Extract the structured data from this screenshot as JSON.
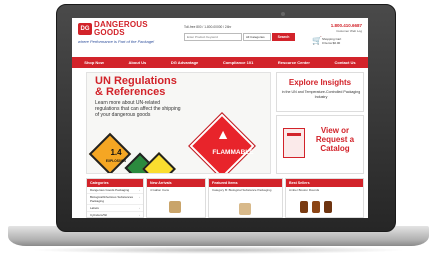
{
  "colors": {
    "brand_red": "#d2232a",
    "nav_text": "#ffffff",
    "tagline_blue": "#2b4c9a"
  },
  "header": {
    "logo_badge": "DG",
    "logo_line1": "DANGEROUS",
    "logo_line2": "GOODS",
    "tagline": "where Performance is Part of the Package!",
    "tollfree": "Toll-free 800 / 1-800-00000 / 24hr",
    "search_placeholder": "Enter Product Keyword",
    "category_select": "All Categories",
    "search_label": "Search",
    "phone": "1.800.410.6687",
    "phone_sub": "Customer Web Log",
    "cart_line1": "Shopping Cart",
    "cart_line2": "0 Items $0.00"
  },
  "nav": {
    "items": [
      "Shop Now",
      "About Us",
      "DG Advantage",
      "Compliance 101",
      "Resource Center",
      "Contact Us"
    ]
  },
  "hero": {
    "title_line1": "UN Regulations",
    "title_line2": "& References",
    "body": "Learn more about UN-related regulations that can affect the shipping of your dangerous goods",
    "hazard_number": "1.4",
    "hazard_label": "EXPLOSIVES",
    "flammable_label": "FLAMMABLE"
  },
  "promo_insights": {
    "title": "Explore Insights",
    "subtitle": "in the UN and Temperature-Controlled Packaging Industry"
  },
  "promo_catalog": {
    "title_line1": "View or",
    "title_line2": "Request a",
    "title_line3": "Catalog"
  },
  "columns": {
    "categories": {
      "heading": "Categories",
      "items": [
        "Dangerous Goods Packaging",
        "Biological/Infectious Substances Packaging",
        "Labels",
        "Cylinders/Wt"
      ]
    },
    "new_arrivals": {
      "heading": "New Arrivals",
      "item": "4 Gallon Cans"
    },
    "featured": {
      "heading": "Featured Items",
      "item": "Category B: Biological Substance Packaging"
    },
    "best_sellers": {
      "heading": "Best Sellers",
      "item": "Amber Boston Rounds"
    }
  }
}
